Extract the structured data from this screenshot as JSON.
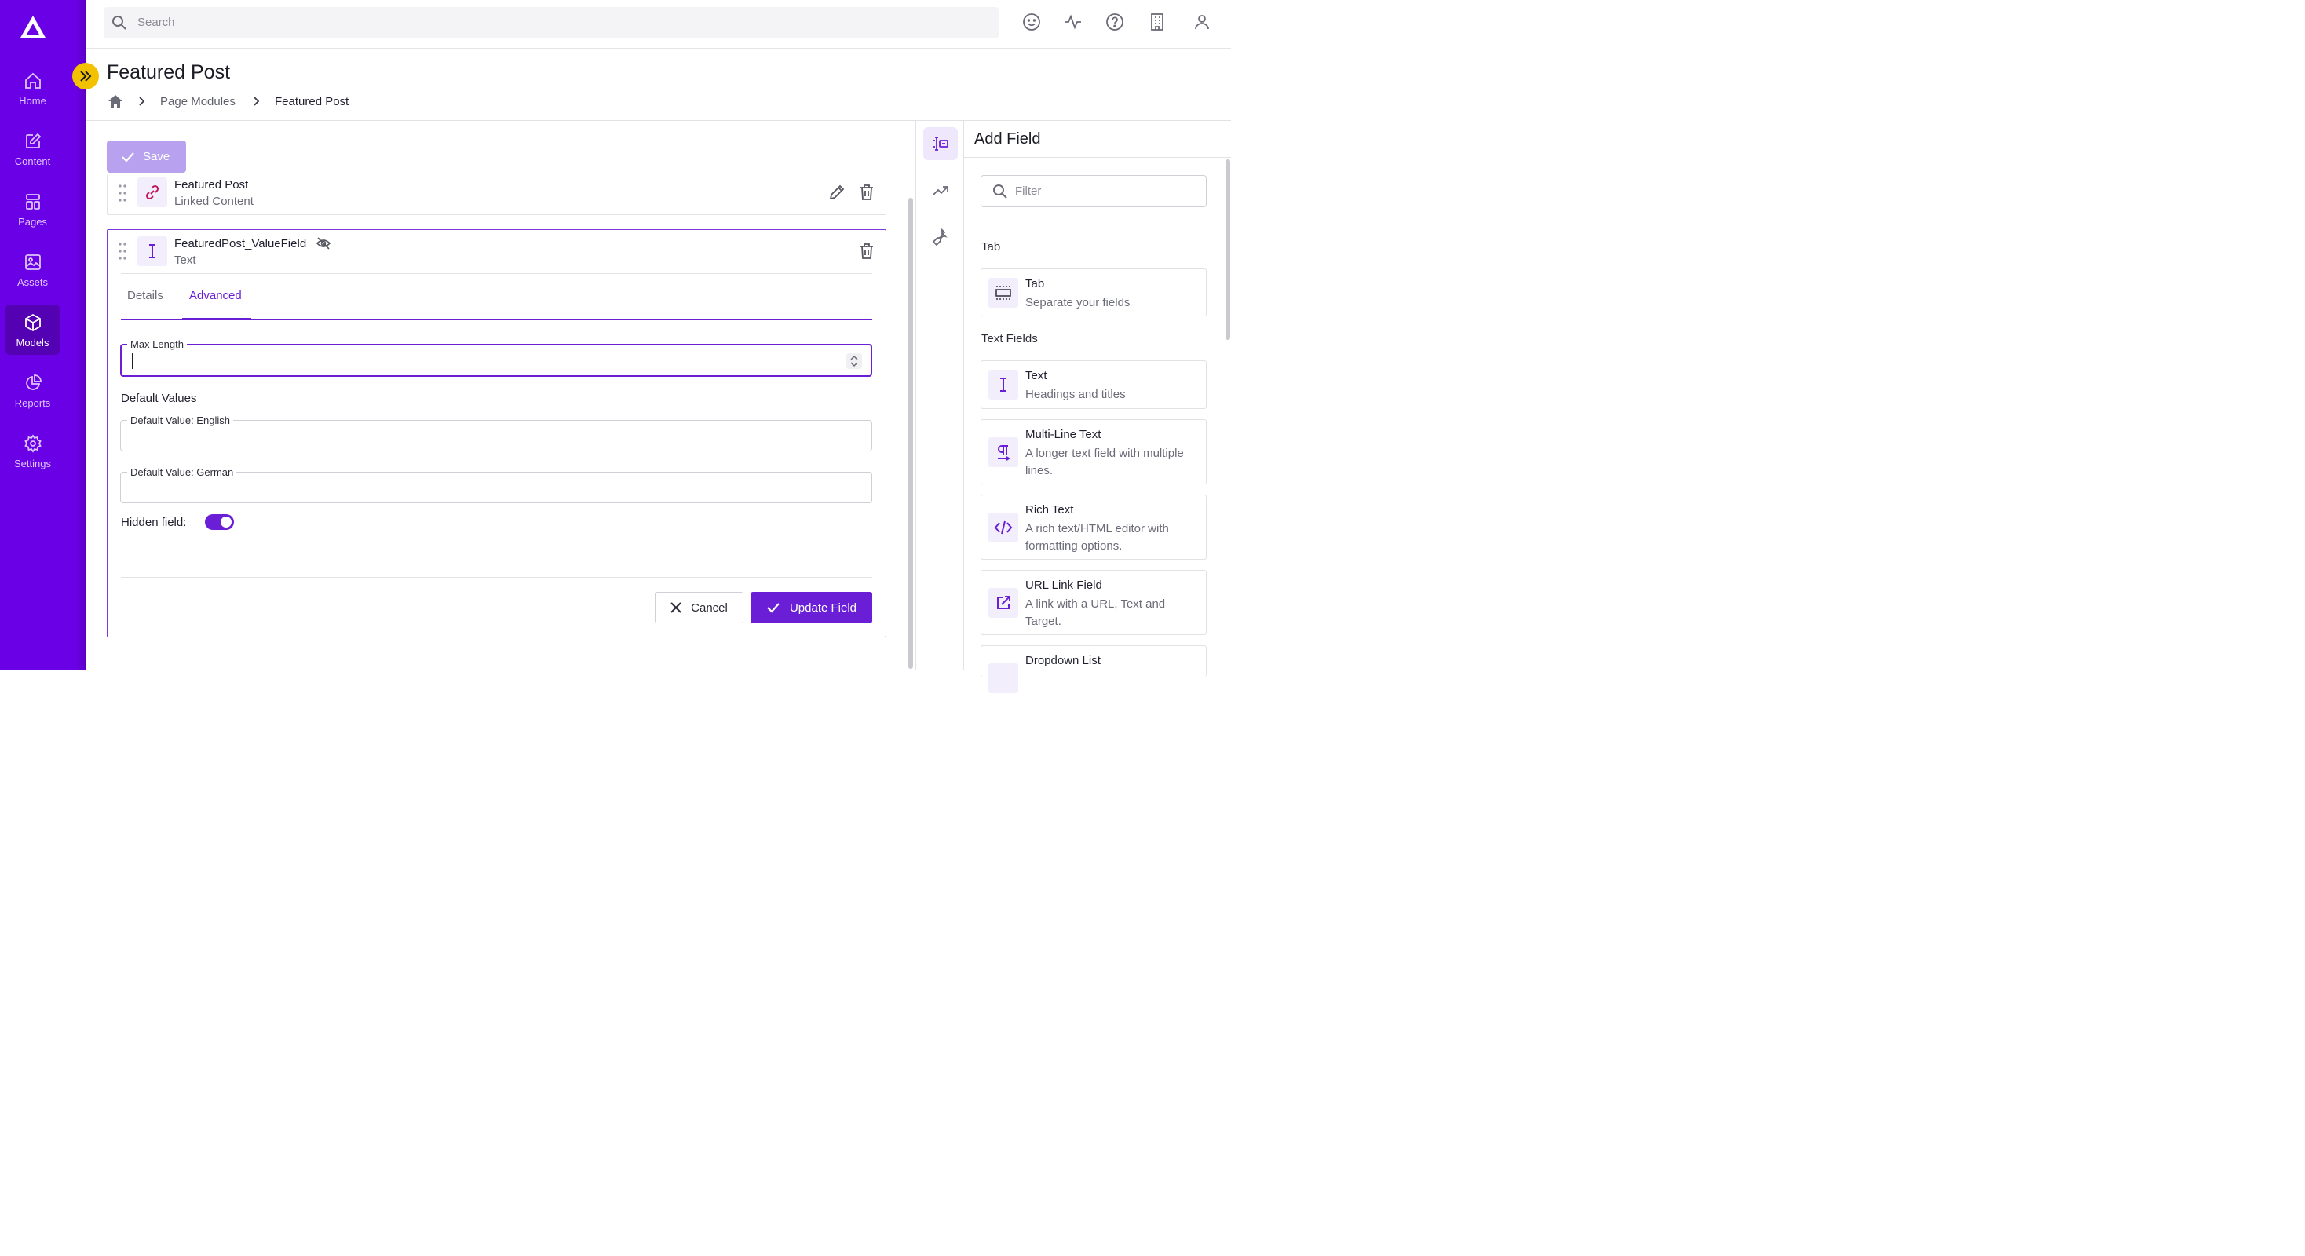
{
  "colors": {
    "sidebar": "#6a00e6",
    "accent": "#6a1fd6",
    "expand_button": "#f2c200",
    "save_disabled": "#b8a2f0"
  },
  "sidebar": {
    "items": [
      {
        "label": "Home",
        "icon": "home-icon"
      },
      {
        "label": "Content",
        "icon": "edit-icon"
      },
      {
        "label": "Pages",
        "icon": "pages-icon"
      },
      {
        "label": "Assets",
        "icon": "image-icon"
      },
      {
        "label": "Models",
        "icon": "cube-icon",
        "active": true
      },
      {
        "label": "Reports",
        "icon": "pie-chart-icon"
      },
      {
        "label": "Settings",
        "icon": "gear-icon"
      }
    ]
  },
  "topbar": {
    "search_placeholder": "Search",
    "icons": [
      "smiley-icon",
      "activity-icon",
      "help-icon",
      "building-icon",
      "user-icon"
    ]
  },
  "header": {
    "title": "Featured Post",
    "breadcrumb": [
      "Page Modules",
      "Featured Post"
    ]
  },
  "toolbar": {
    "save_label": "Save"
  },
  "fields": [
    {
      "name": "Featured Post",
      "type": "Linked Content",
      "icon": "link-icon"
    },
    {
      "name": "FeaturedPost_ValueField",
      "type": "Text",
      "icon": "text-cursor-icon",
      "hidden": true
    }
  ],
  "editor": {
    "tabs": [
      "Details",
      "Advanced"
    ],
    "active_tab": "Advanced",
    "max_length_label": "Max Length",
    "max_length_value": "",
    "default_values_heading": "Default Values",
    "default_english_label": "Default Value: English",
    "default_english_value": "",
    "default_german_label": "Default Value: German",
    "default_german_value": "",
    "hidden_label": "Hidden field:",
    "hidden_on": true,
    "cancel_label": "Cancel",
    "update_label": "Update Field"
  },
  "tool_strip": [
    "field-list-icon",
    "trending-icon",
    "wrench-icon"
  ],
  "add_field": {
    "title": "Add Field",
    "filter_placeholder": "Filter",
    "sections": [
      {
        "label": "Tab",
        "items": [
          {
            "name": "Tab",
            "desc": "Separate your fields",
            "icon": "tab-icon"
          }
        ]
      },
      {
        "label": "Text Fields",
        "items": [
          {
            "name": "Text",
            "desc": "Headings and titles",
            "icon": "text-cursor-icon"
          },
          {
            "name": "Multi-Line Text",
            "desc": "A longer text field with multiple lines.",
            "icon": "paragraph-icon"
          },
          {
            "name": "Rich Text",
            "desc": "A rich text/HTML editor with formatting options.",
            "icon": "code-icon"
          },
          {
            "name": "URL Link Field",
            "desc": "A link with a URL, Text and Target.",
            "icon": "external-link-icon"
          },
          {
            "name": "Dropdown List",
            "desc": "",
            "icon": "dropdown-icon"
          }
        ]
      }
    ]
  }
}
